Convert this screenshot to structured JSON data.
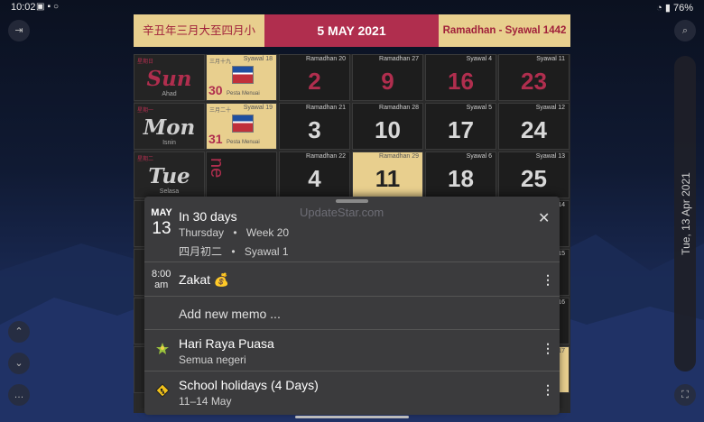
{
  "status": {
    "time": "10:02",
    "battery": "76%"
  },
  "header": {
    "chinese_month": "辛丑年三月大至四月小",
    "date": "5 MAY 2021",
    "islamic_month": "Ramadhan - Syawal 1442"
  },
  "side": {
    "vertical_date": "Tue, 13 Apr 2021"
  },
  "calendar": {
    "rows": [
      {
        "day": {
          "cn": "星期日",
          "name": "Sun",
          "sub": "Ahad",
          "red": true
        },
        "cells": [
          {
            "hijri": "Syawal 18",
            "num": "30",
            "cn": "三月十九",
            "holiday": "Pesta Menuai",
            "type": "holiday"
          },
          {
            "hijri": "Ramadhan 20",
            "num": "2",
            "red": true
          },
          {
            "hijri": "Ramadhan 27",
            "num": "9",
            "red": true
          },
          {
            "hijri": "Syawal 4",
            "num": "16",
            "red": true
          },
          {
            "hijri": "Syawal 11",
            "num": "23",
            "red": true
          }
        ]
      },
      {
        "day": {
          "cn": "星期一",
          "name": "Mon",
          "sub": "Isnin",
          "red": false
        },
        "cells": [
          {
            "hijri": "Syawal 19",
            "num": "31",
            "cn": "三月二十",
            "holiday": "Pesta Menuai",
            "type": "holiday"
          },
          {
            "hijri": "Ramadhan 21",
            "num": "3"
          },
          {
            "hijri": "Ramadhan 28",
            "num": "10"
          },
          {
            "hijri": "Syawal 5",
            "num": "17"
          },
          {
            "hijri": "Syawal 12",
            "num": "24"
          }
        ]
      },
      {
        "day": {
          "cn": "星期二",
          "name": "Tue",
          "sub": "Selasa",
          "red": false
        },
        "cells": [
          {
            "type": "partial",
            "text": "ne"
          },
          {
            "hijri": "Ramadhan 22",
            "num": "4"
          },
          {
            "hijri": "Ramadhan 29",
            "num": "11",
            "gold": true
          },
          {
            "hijri": "Syawal 6",
            "num": "18"
          },
          {
            "hijri": "Syawal 13",
            "num": "25"
          }
        ]
      }
    ],
    "right_edge_hijri": [
      "14",
      "15",
      "16",
      "17"
    ]
  },
  "sheet": {
    "watermark": "UpdateStar.com",
    "date_month": "MAY",
    "date_day": "13",
    "title": "In 30 days",
    "weekday": "Thursday",
    "week": "Week 20",
    "sep": "•",
    "chinese_date": "四月初二",
    "hijri_date": "Syawal 1",
    "memo": {
      "time_hour": "8:00",
      "time_ampm": "am",
      "title": "Zakat 💰"
    },
    "add_memo": "Add new memo ...",
    "events": [
      {
        "title": "Hari Raya Puasa",
        "sub": "Semua negeri",
        "icon": "celebration-icon"
      },
      {
        "title": "School holidays (4 Days)",
        "sub": "11–14 May",
        "icon": "school-sign-icon"
      }
    ],
    "close_glyph": "✕",
    "kebab_glyph": "⋮"
  },
  "colors": {
    "gold": "#e8cf8e",
    "crimson": "#b02e4e",
    "sheet": "#3b3b3d"
  }
}
